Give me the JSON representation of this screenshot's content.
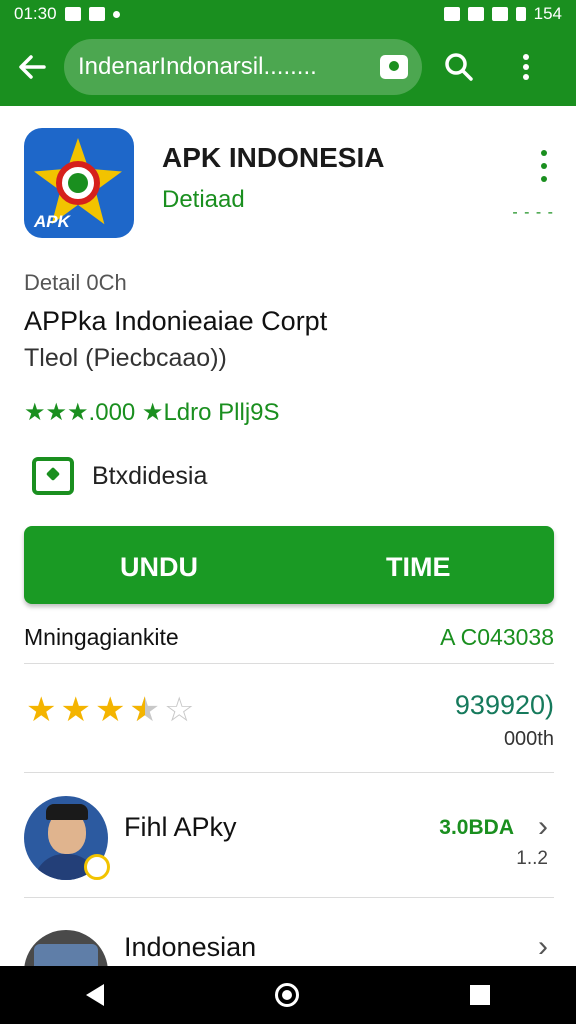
{
  "status_bar": {
    "time": "01:30",
    "battery": "154"
  },
  "toolbar": {
    "search_query": "IndenarIndonarsil........"
  },
  "app": {
    "title": "APK INDONESIA",
    "subtitle": "Detiaad",
    "icon_text": "APK",
    "dashes": "- - - -"
  },
  "details": {
    "label": "Detail 0Ch",
    "developer": "APPka Indonieaiae Corpt",
    "type": "Tleol (Piecbcaao))",
    "rating_line": "★★★.000 ★Ldro Pllj9S",
    "badge_text": "Btxdidesia"
  },
  "action_button": {
    "left_label": "UNDU",
    "right_label": "TIME"
  },
  "info": {
    "key": "Mningagiankite",
    "value": "A C043038"
  },
  "rating": {
    "stars": 3.5,
    "count": "939920)",
    "sub": "000th"
  },
  "list": [
    {
      "title": "Fihl APky",
      "value": "3.0BDA",
      "sub": "1..2"
    },
    {
      "title": "Indonesian"
    }
  ],
  "colors": {
    "primary": "#1a8f1f",
    "button": "#1a9a24",
    "star": "#f4b400",
    "rating_count": "#167a5c"
  }
}
